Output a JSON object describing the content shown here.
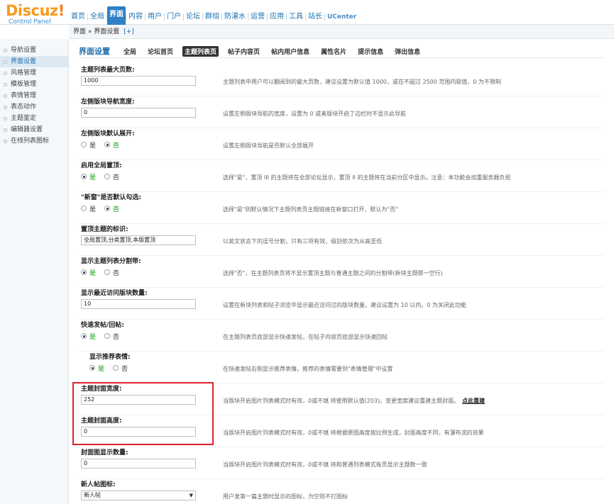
{
  "header": {
    "logo_text": "Discuz",
    "logo_bang": "!",
    "logo_sub": "Control Panel",
    "nav": [
      "首页",
      "全局",
      "界面",
      "内容",
      "用户",
      "门户",
      "论坛",
      "群组",
      "防灌水",
      "运营",
      "应用",
      "工具",
      "站长",
      "UCenter"
    ],
    "active_nav": "界面"
  },
  "breadcrumb": {
    "path": "界面 » 界面设置",
    "add": "[+]"
  },
  "sidebar": {
    "items": [
      "导航设置",
      "界面设置",
      "风格管理",
      "模板管理",
      "表情管理",
      "表态动作",
      "主题鉴定",
      "编辑器设置",
      "在线列表图标"
    ],
    "active": "界面设置"
  },
  "subtabs": {
    "title": "界面设置",
    "tabs": [
      "全局",
      "论坛首页",
      "主题列表页",
      "帖子内容页",
      "帖内用户信息",
      "属性名片",
      "提示信息",
      "弹出信息"
    ],
    "active": "主题列表页"
  },
  "radio_labels": {
    "yes": "是",
    "no": "否"
  },
  "settings": [
    {
      "label": "主题列表最大页数:",
      "type": "text",
      "value": "1000",
      "desc": "主题列表中用户可以翻阅到的最大页数，建议设置为默认值 1000，或在不超过 2500 范围内取值，0 为不限制"
    },
    {
      "label": "左侧版块导航宽度:",
      "type": "text",
      "value": "0",
      "desc": "设置左侧版块导航的宽度，设置为 0 或者版块开启了边栏时不显示此导航"
    },
    {
      "label": "左侧版块默认展开:",
      "type": "radio",
      "value": "no",
      "desc": "设置左侧版块导航是否默认全部展开"
    },
    {
      "label": "启用全局置顶:",
      "type": "radio",
      "value": "yes",
      "desc": "选择\"是\"，置顶 III 的主题将在全部论坛显示，置顶 II 的主题将在当前分区中显示。注意：本功能会加重服务器负担"
    },
    {
      "label": "\"新窗\"是否默认勾选:",
      "type": "radio",
      "value": "no",
      "desc": "选择\"是\"则默认情况下主题列表页主题链接在新窗口打开，默认为\"否\""
    },
    {
      "label": "置顶主题的标识:",
      "type": "text",
      "value": "全局置顶,分类置顶,本版置顶",
      "desc": "以英文状态下的逗号分割，只有三项有效，级别依次为从高至低"
    },
    {
      "label": "显示主题列表分割带:",
      "type": "radio",
      "value": "yes",
      "desc": "选择\"否\"，在主题列表页将不显示置顶主题与普通主题之间的分割带(新块主题那一空行)"
    },
    {
      "label": "显示最近访问版块数量:",
      "type": "text",
      "value": "10",
      "desc": "设置在新块列表和帖子浏览中显示最近访问过的版块数量，建议设置为 10 以内，0 为关闭此功能"
    },
    {
      "label": "快速发帖/回帖:",
      "type": "radio",
      "value": "yes",
      "desc": "在主题列表页底部显示快速发帖，在帖子内容页底部显示快速回帖"
    },
    {
      "label": "显示推荐表情:",
      "type": "radio",
      "value": "yes",
      "desc": "在快速发帖右侧显示推荐表情。推荐的表情需要到\"表情管理\"中设置",
      "indent": true
    },
    {
      "label": "主题封面宽度:",
      "type": "text",
      "value": "252",
      "desc": "当版块开启图片列表模式时有效，0或不填 将使用默认值(203)。变更宽度建议重建主题封面。",
      "link": "点此重建"
    },
    {
      "label": "主题封面高度:",
      "type": "text",
      "value": "0",
      "desc": "当版块开启图片列表模式时有效，0或不填 将根据原图高度按比例生成，封面高度不同，有瀑布流的效果"
    },
    {
      "label": "封面图显示数量:",
      "type": "text",
      "value": "0",
      "desc": "当版块开启图片列表模式时有效，0或不填 将和普通列表模式每页显示主题数一致"
    },
    {
      "label": "新人帖图标:",
      "type": "select",
      "value": "新人帖",
      "desc": "用户发第一篇主题时显示的图标，为空则不打图标"
    }
  ]
}
